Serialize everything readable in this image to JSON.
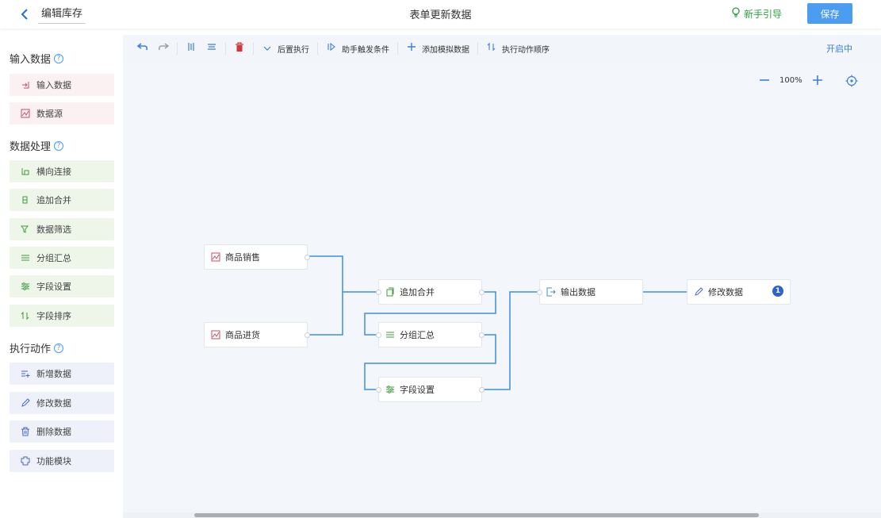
{
  "header": {
    "back_icon": "chevron-left-icon",
    "page_name": "编辑库存",
    "title": "表单更新数据",
    "guide_label": "新手引导",
    "save_label": "保存"
  },
  "sidebar": {
    "sections": [
      {
        "title": "输入数据",
        "items": [
          {
            "label": "输入数据",
            "icon": "input-icon"
          },
          {
            "label": "数据源",
            "icon": "chart-icon"
          }
        ]
      },
      {
        "title": "数据处理",
        "items": [
          {
            "label": "横向连接",
            "icon": "join-icon"
          },
          {
            "label": "追加合并",
            "icon": "append-icon"
          },
          {
            "label": "数据筛选",
            "icon": "filter-icon"
          },
          {
            "label": "分组汇总",
            "icon": "list-icon"
          },
          {
            "label": "字段设置",
            "icon": "sliders-icon"
          },
          {
            "label": "字段排序",
            "icon": "sort-icon"
          }
        ]
      },
      {
        "title": "执行动作",
        "items": [
          {
            "label": "新增数据",
            "icon": "add-list-icon"
          },
          {
            "label": "修改数据",
            "icon": "edit-icon"
          },
          {
            "label": "删除数据",
            "icon": "trash-icon"
          },
          {
            "label": "功能模块",
            "icon": "module-icon"
          }
        ]
      }
    ]
  },
  "toolbar": {
    "post_exec": "后置执行",
    "trigger": "助手触发条件",
    "mock_data": "添加模拟数据",
    "order": "执行动作顺序",
    "status": "开启中"
  },
  "canvas": {
    "zoom": "100%",
    "nodes": [
      {
        "label": "商品销售",
        "icon": "chart-icon"
      },
      {
        "label": "商品进货",
        "icon": "chart-icon"
      },
      {
        "label": "追加合并",
        "icon": "append-icon"
      },
      {
        "label": "分组汇总",
        "icon": "list-icon"
      },
      {
        "label": "字段设置",
        "icon": "sliders-icon"
      },
      {
        "label": "输出数据",
        "icon": "output-icon"
      },
      {
        "label": "修改数据",
        "icon": "edit-icon"
      }
    ],
    "badge": "1"
  },
  "colors": {
    "accent": "#4c9cf2",
    "edge": "#3d8fd9",
    "guide": "#2e9e3f",
    "canvas_bg": "#f3f6fb"
  }
}
